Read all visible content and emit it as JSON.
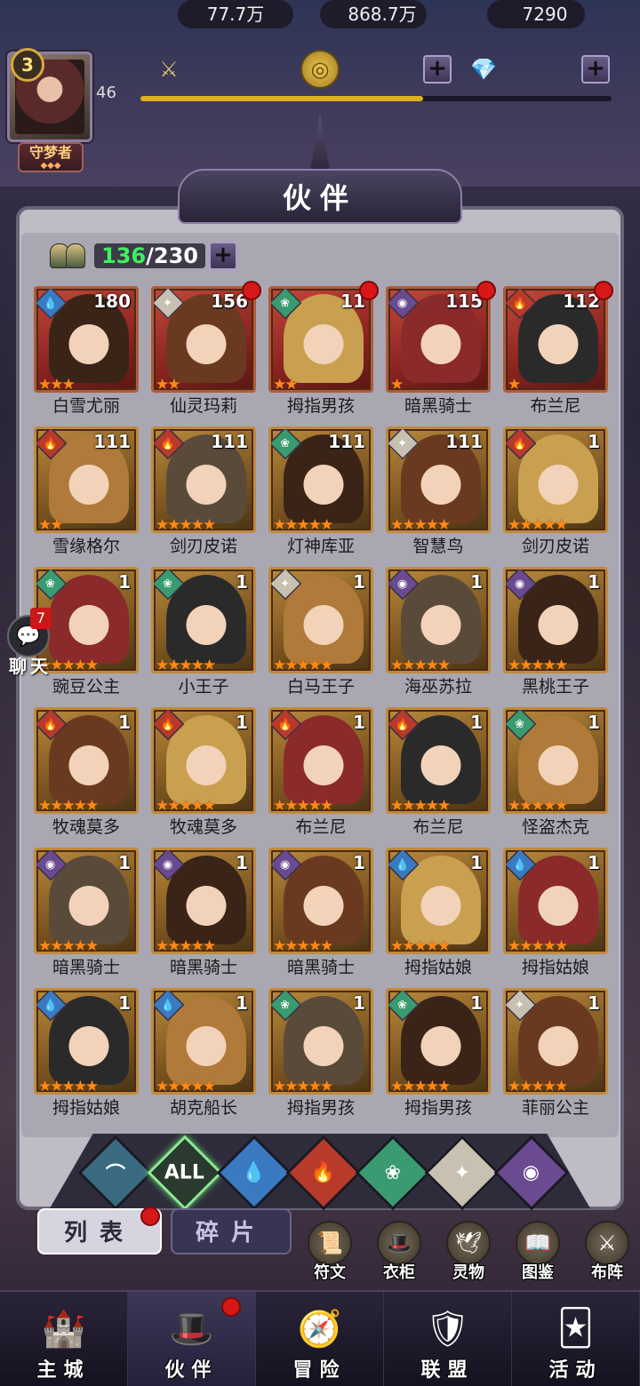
{
  "player": {
    "vip_level": "3",
    "level": "46",
    "title": "守梦者",
    "title_dots": "◆◆◆",
    "xp_fraction": 0.6
  },
  "resources": {
    "power": "77.7万",
    "gold": "868.7万",
    "diamonds": "7290"
  },
  "header": {
    "title": "伙伴"
  },
  "roster": {
    "current": "136",
    "separator": "/",
    "max": "230"
  },
  "heroes": [
    {
      "name": "白雪尤丽",
      "level": "180",
      "element": "water",
      "stars": "★★★",
      "dot": false,
      "bg": "red"
    },
    {
      "name": "仙灵玛莉",
      "level": "156",
      "element": "light",
      "stars": "★★",
      "dot": true,
      "bg": "red"
    },
    {
      "name": "拇指男孩",
      "level": "11",
      "element": "wind",
      "stars": "★★",
      "dot": true,
      "bg": "red"
    },
    {
      "name": "暗黑骑士",
      "level": "115",
      "element": "dark",
      "stars": "★",
      "dot": true,
      "bg": "red"
    },
    {
      "name": "布兰尼",
      "level": "112",
      "element": "fire",
      "stars": "★",
      "dot": true,
      "bg": "red"
    },
    {
      "name": "雪缘格尔",
      "level": "111",
      "element": "fire",
      "stars": "★★",
      "dot": false,
      "bg": "gold"
    },
    {
      "name": "剑刃皮诺",
      "level": "111",
      "element": "fire",
      "stars": "★★★★★",
      "dot": false,
      "bg": "gold"
    },
    {
      "name": "灯神库亚",
      "level": "111",
      "element": "wind",
      "stars": "★★★★★",
      "dot": false,
      "bg": "gold"
    },
    {
      "name": "智慧鸟",
      "level": "111",
      "element": "light",
      "stars": "★★★★★",
      "dot": false,
      "bg": "gold"
    },
    {
      "name": "剑刃皮诺",
      "level": "1",
      "element": "fire",
      "stars": "★★★★★",
      "dot": false,
      "bg": "gold"
    },
    {
      "name": "豌豆公主",
      "level": "1",
      "element": "wind",
      "stars": "★★★★★",
      "dot": false,
      "bg": "gold"
    },
    {
      "name": "小王子",
      "level": "1",
      "element": "wind",
      "stars": "★★★★★",
      "dot": false,
      "bg": "gold"
    },
    {
      "name": "白马王子",
      "level": "1",
      "element": "light",
      "stars": "★★★★★",
      "dot": false,
      "bg": "gold"
    },
    {
      "name": "海巫苏拉",
      "level": "1",
      "element": "dark",
      "stars": "★★★★★",
      "dot": false,
      "bg": "gold"
    },
    {
      "name": "黑桃王子",
      "level": "1",
      "element": "dark",
      "stars": "★★★★★",
      "dot": false,
      "bg": "gold"
    },
    {
      "name": "牧魂莫多",
      "level": "1",
      "element": "fire",
      "stars": "★★★★★",
      "dot": false,
      "bg": "gold"
    },
    {
      "name": "牧魂莫多",
      "level": "1",
      "element": "fire",
      "stars": "★★★★★",
      "dot": false,
      "bg": "gold"
    },
    {
      "name": "布兰尼",
      "level": "1",
      "element": "fire",
      "stars": "★★★★★",
      "dot": false,
      "bg": "gold"
    },
    {
      "name": "布兰尼",
      "level": "1",
      "element": "fire",
      "stars": "★★★★★",
      "dot": false,
      "bg": "gold"
    },
    {
      "name": "怪盗杰克",
      "level": "1",
      "element": "wind",
      "stars": "★★★★★",
      "dot": false,
      "bg": "gold"
    },
    {
      "name": "暗黑骑士",
      "level": "1",
      "element": "dark",
      "stars": "★★★★★",
      "dot": false,
      "bg": "gold"
    },
    {
      "name": "暗黑骑士",
      "level": "1",
      "element": "dark",
      "stars": "★★★★★",
      "dot": false,
      "bg": "gold"
    },
    {
      "name": "暗黑骑士",
      "level": "1",
      "element": "dark",
      "stars": "★★★★★",
      "dot": false,
      "bg": "gold"
    },
    {
      "name": "拇指姑娘",
      "level": "1",
      "element": "water",
      "stars": "★★★★★",
      "dot": false,
      "bg": "gold"
    },
    {
      "name": "拇指姑娘",
      "level": "1",
      "element": "water",
      "stars": "★★★★★",
      "dot": false,
      "bg": "gold"
    },
    {
      "name": "拇指姑娘",
      "level": "1",
      "element": "water",
      "stars": "★★★★★",
      "dot": false,
      "bg": "gold"
    },
    {
      "name": "胡克船长",
      "level": "1",
      "element": "water",
      "stars": "★★★★★",
      "dot": false,
      "bg": "gold"
    },
    {
      "name": "拇指男孩",
      "level": "1",
      "element": "wind",
      "stars": "★★★★★",
      "dot": false,
      "bg": "gold"
    },
    {
      "name": "拇指男孩",
      "level": "1",
      "element": "wind",
      "stars": "★★★★★",
      "dot": false,
      "bg": "gold"
    },
    {
      "name": "菲丽公主",
      "level": "1",
      "element": "light",
      "stars": "★★★★★",
      "dot": false,
      "bg": "gold"
    }
  ],
  "element_glyphs": {
    "water": "💧",
    "light": "✦",
    "wind": "❀",
    "dark": "◉",
    "fire": "🔥"
  },
  "chat": {
    "count": "7",
    "label": "聊天"
  },
  "filters": [
    {
      "id": "neutral",
      "label": "⌒",
      "color": "#3a6a80"
    },
    {
      "id": "all",
      "label": "ALL",
      "color": "#2a3a2e"
    },
    {
      "id": "water",
      "label": "💧",
      "color": "#3a7ac0"
    },
    {
      "id": "fire",
      "label": "🔥",
      "color": "#b83a2a"
    },
    {
      "id": "wind",
      "label": "❀",
      "color": "#3a9a70"
    },
    {
      "id": "light",
      "label": "✦",
      "color": "#c8c0b0"
    },
    {
      "id": "dark",
      "label": "◉",
      "color": "#6a4a90"
    }
  ],
  "tabs": {
    "list": "列表",
    "shards": "碎片"
  },
  "features": [
    {
      "label": "符文",
      "icon": "📜"
    },
    {
      "label": "衣柜",
      "icon": "🎩"
    },
    {
      "label": "灵物",
      "icon": "🕊"
    },
    {
      "label": "图鉴",
      "icon": "📖"
    },
    {
      "label": "布阵",
      "icon": "⚔"
    }
  ],
  "nav": [
    {
      "label": "主城",
      "icon": "🏰",
      "active": false,
      "dot": false
    },
    {
      "label": "伙伴",
      "icon": "🎩",
      "active": true,
      "dot": true
    },
    {
      "label": "冒险",
      "icon": "🧭",
      "active": false,
      "dot": false
    },
    {
      "label": "联盟",
      "icon": "🛡",
      "active": false,
      "dot": false
    },
    {
      "label": "活动",
      "icon": "🃏",
      "active": false,
      "dot": false
    }
  ]
}
